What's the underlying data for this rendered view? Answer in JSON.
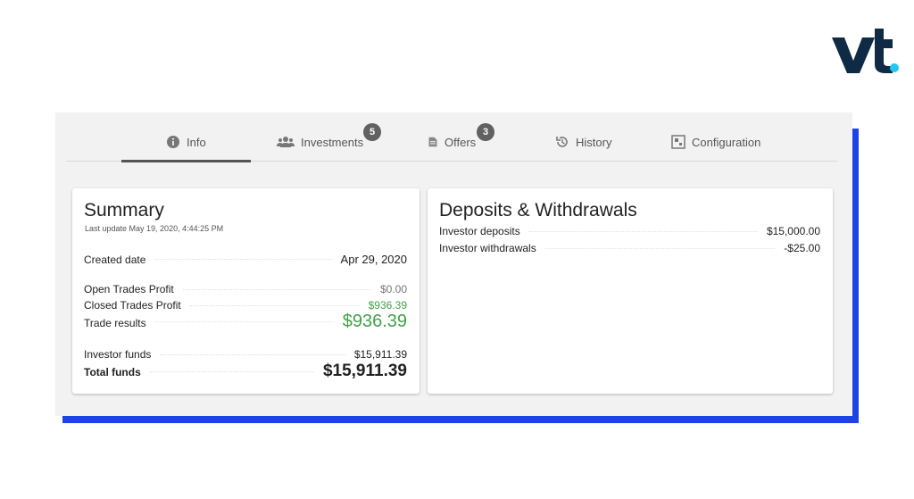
{
  "tabs": [
    {
      "label": "Info",
      "icon": "info-icon"
    },
    {
      "label": "Investments",
      "icon": "users-icon",
      "badge": "5"
    },
    {
      "label": "Offers",
      "icon": "document-icon",
      "badge": "3"
    },
    {
      "label": "History",
      "icon": "history-icon"
    },
    {
      "label": "Configuration",
      "icon": "configuration-icon"
    }
  ],
  "summary": {
    "title": "Summary",
    "last_update": "Last update May 19, 2020, 4:44:25 PM",
    "created_date_label": "Created date",
    "created_date_value": "Apr 29, 2020",
    "open_trades_label": "Open Trades Profit",
    "open_trades_value": "$0.00",
    "closed_trades_label": "Closed Trades Profit",
    "closed_trades_value": "$936.39",
    "trade_results_label": "Trade results",
    "trade_results_value": "$936.39",
    "investor_funds_label": "Investor funds",
    "investor_funds_value": "$15,911.39",
    "total_funds_label": "Total funds",
    "total_funds_value": "$15,911.39"
  },
  "deposits": {
    "title": "Deposits & Withdrawals",
    "investor_deposits_label": "Investor deposits",
    "investor_deposits_value": "$15,000.00",
    "investor_withdrawals_label": "Investor withdrawals",
    "investor_withdrawals_value": "-$25.00"
  },
  "colors": {
    "accent_blue": "#1d43e6",
    "logo_navy": "#0f2a44",
    "logo_dot": "#1ec8f0",
    "profit_green": "#43a047",
    "badge_gray": "#616161"
  }
}
